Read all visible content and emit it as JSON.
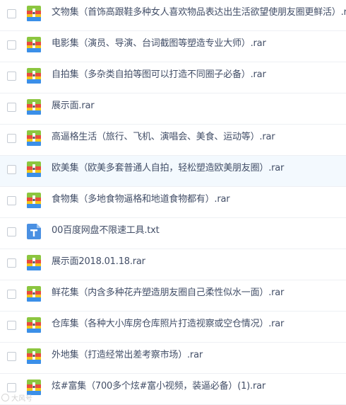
{
  "files": [
    {
      "name": "文物集（首饰高跟鞋多种女人喜欢物品表达出生活欲望使朋友圈更鲜活）.rar",
      "icon": "rar-archive-icon",
      "highlighted": false
    },
    {
      "name": "电影集（演员、导演、台词截图等塑造专业大师）.rar",
      "icon": "rar-archive-icon",
      "highlighted": false
    },
    {
      "name": "自拍集（多杂类自拍等图可以打造不同圈子必备）.rar",
      "icon": "rar-archive-icon",
      "highlighted": false
    },
    {
      "name": "展示面.rar",
      "icon": "rar-archive-icon",
      "highlighted": false
    },
    {
      "name": "高逼格生活（旅行、飞机、演唱会、美食、运动等）.rar",
      "icon": "rar-archive-icon",
      "highlighted": false
    },
    {
      "name": "欧美集（欧美多套普通人自拍，轻松塑造欧美朋友圈）.rar",
      "icon": "rar-archive-icon",
      "highlighted": true
    },
    {
      "name": "食物集（多地食物逼格和地道食物都有）.rar",
      "icon": "rar-archive-icon",
      "highlighted": false
    },
    {
      "name": "00百度网盘不限速工具.txt",
      "icon": "txt-document-icon",
      "highlighted": false
    },
    {
      "name": "展示面2018.01.18.rar",
      "icon": "rar-archive-icon",
      "highlighted": false
    },
    {
      "name": "鲜花集（内含多种花卉塑造朋友圈自己柔性似水一面）.rar",
      "icon": "rar-archive-icon",
      "highlighted": false
    },
    {
      "name": "仓库集（各种大小库房仓库照片打造视察或空仓情况）.rar",
      "icon": "rar-archive-icon",
      "highlighted": false
    },
    {
      "name": "外地集（打造经常出差考察市场）.rar",
      "icon": "rar-archive-icon",
      "highlighted": false
    },
    {
      "name": "炫#富集（700多个炫#富小视频，装逼必备）(1).rar",
      "icon": "rar-archive-icon",
      "highlighted": false
    }
  ],
  "watermark": {
    "text": "大风号"
  },
  "colors": {
    "text": "#424e67",
    "row_highlight": "#f3f9fe",
    "divider": "#eef0f4",
    "rar_green": "#8cc63f",
    "rar_red": "#e94b3c",
    "rar_yellow": "#f5c518",
    "rar_blue": "#3b8fe8",
    "txt_blue": "#4a90e2"
  }
}
